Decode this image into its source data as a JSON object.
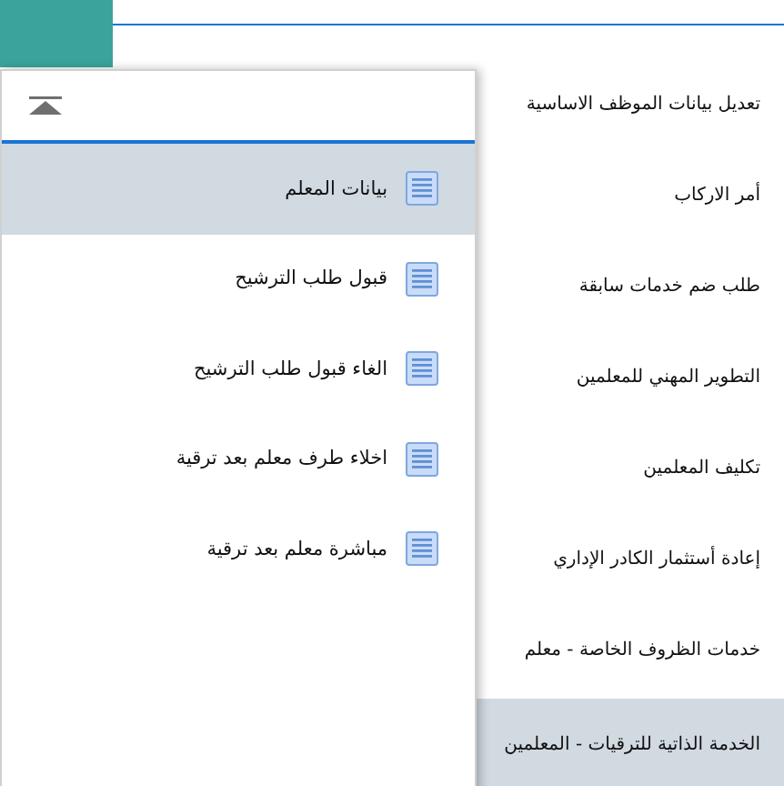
{
  "menu": {
    "items": [
      {
        "label": "تعديل بيانات الموظف الاساسية",
        "selected": false
      },
      {
        "label": "أمر الاركاب",
        "selected": false
      },
      {
        "label": "طلب ضم خدمات سابقة",
        "selected": false
      },
      {
        "label": "التطوير المهني للمعلمين",
        "selected": false
      },
      {
        "label": "تكليف المعلمين",
        "selected": false
      },
      {
        "label": "إعادة أستثمار الكادر الإداري",
        "selected": false
      },
      {
        "label": "خدمات الظروف الخاصة - معلم",
        "selected": false
      },
      {
        "label": "الخدمة الذاتية للترقيات - المعلمين",
        "selected": true
      }
    ]
  },
  "submenu": {
    "items": [
      {
        "label": "بيانات المعلم",
        "selected": true
      },
      {
        "label": "قبول طلب الترشيح",
        "selected": false
      },
      {
        "label": "الغاء قبول طلب الترشيح",
        "selected": false
      },
      {
        "label": "اخلاء طرف معلم بعد ترقية",
        "selected": false
      },
      {
        "label": "مباشرة معلم بعد ترقية",
        "selected": false
      }
    ]
  }
}
